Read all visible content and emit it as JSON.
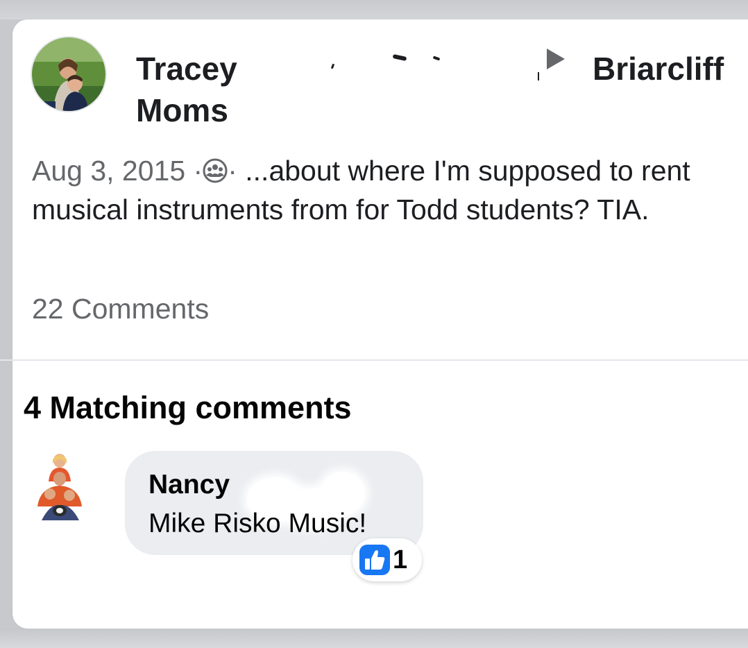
{
  "post": {
    "author_first": "Tracey",
    "group_line": "Moms",
    "group_prefix": "Briarcliff",
    "date": "Aug 3, 2015",
    "separator": "·",
    "privacy_icon": "group-members-icon",
    "text": "...about where I'm supposed to rent musical instruments from for Todd students? TIA.",
    "comments_count": "22 Comments"
  },
  "matching": {
    "title": "4 Matching comments",
    "comments": [
      {
        "author": "Nancy",
        "text": "Mike Risko Music!",
        "reaction_icon": "thumbs-up-icon",
        "reaction_count": "1"
      }
    ]
  },
  "colors": {
    "like_blue": "#1877f2",
    "secondary_text": "#65676b",
    "bubble_bg": "#ebedf0"
  }
}
